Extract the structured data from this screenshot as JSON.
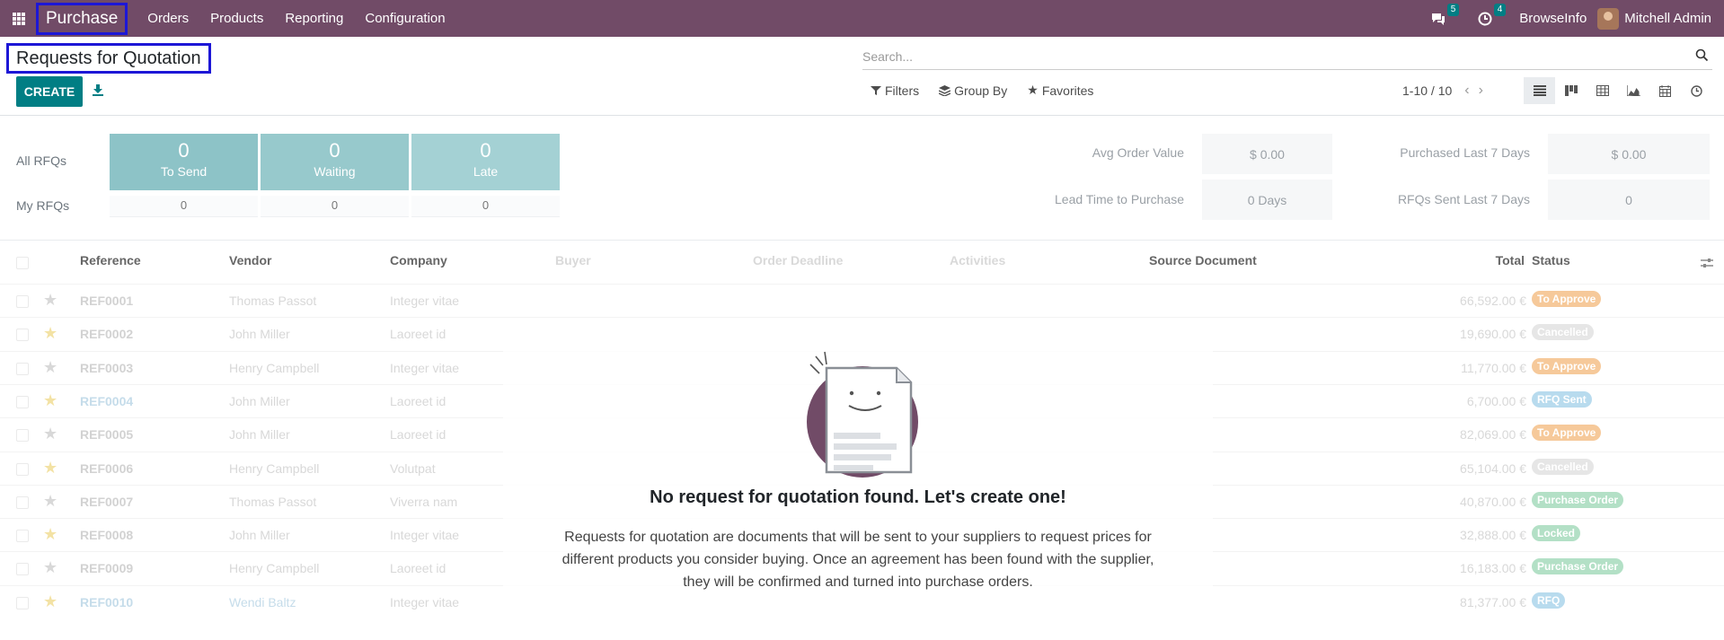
{
  "navbar": {
    "app_name": "Purchase",
    "menu": [
      "Orders",
      "Products",
      "Reporting",
      "Configuration"
    ],
    "messages_count": "5",
    "activities_count": "4",
    "browse_info": "BrowseInfo",
    "user_name": "Mitchell Admin"
  },
  "control_panel": {
    "title": "Requests for Quotation",
    "create_label": "CREATE",
    "search_placeholder": "Search...",
    "filters_label": "Filters",
    "group_by_label": "Group By",
    "favorites_label": "Favorites",
    "pager": "1-10 / 10"
  },
  "dashboard": {
    "all_rfqs_label": "All RFQs",
    "my_rfqs_label": "My RFQs",
    "tiles": [
      {
        "value": "0",
        "label": "To Send",
        "my_value": "0"
      },
      {
        "value": "0",
        "label": "Waiting",
        "my_value": "0"
      },
      {
        "value": "0",
        "label": "Late",
        "my_value": "0"
      }
    ],
    "kpis": {
      "avg_order_value_label": "Avg Order Value",
      "avg_order_value": "$ 0.00",
      "lead_time_label": "Lead Time to Purchase",
      "lead_time": "0 Days",
      "purchased_7d_label": "Purchased Last 7 Days",
      "purchased_7d": "$ 0.00",
      "rfqs_sent_7d_label": "RFQs Sent Last 7 Days",
      "rfqs_sent_7d": "0"
    }
  },
  "list": {
    "columns": [
      "Reference",
      "Vendor",
      "Company",
      "Buyer",
      "Order Deadline",
      "Activities",
      "Source Document",
      "Total",
      "Status"
    ],
    "rows": [
      {
        "ref": "REF0001",
        "vendor": "Thomas Passot",
        "company": "Integer vitae",
        "total": "66,592.00 €",
        "status": "To Approve",
        "starred": false
      },
      {
        "ref": "REF0002",
        "vendor": "John Miller",
        "company": "Laoreet id",
        "total": "19,690.00 €",
        "status": "Cancelled",
        "starred": true
      },
      {
        "ref": "REF0003",
        "vendor": "Henry Campbell",
        "company": "Integer vitae",
        "total": "11,770.00 €",
        "status": "To Approve",
        "starred": false
      },
      {
        "ref": "REF0004",
        "vendor": "John Miller",
        "company": "Laoreet id",
        "total": "6,700.00 €",
        "status": "RFQ Sent",
        "starred": true
      },
      {
        "ref": "REF0005",
        "vendor": "John Miller",
        "company": "Laoreet id",
        "total": "82,069.00 €",
        "status": "To Approve",
        "starred": false
      },
      {
        "ref": "REF0006",
        "vendor": "Henry Campbell",
        "company": "Volutpat",
        "total": "65,104.00 €",
        "status": "Cancelled",
        "starred": true
      },
      {
        "ref": "REF0007",
        "vendor": "Thomas Passot",
        "company": "Viverra nam",
        "total": "40,870.00 €",
        "status": "Purchase Order",
        "starred": false
      },
      {
        "ref": "REF0008",
        "vendor": "John Miller",
        "company": "Integer vitae",
        "total": "32,888.00 €",
        "status": "Locked",
        "starred": true
      },
      {
        "ref": "REF0009",
        "vendor": "Henry Campbell",
        "company": "Laoreet id",
        "total": "16,183.00 €",
        "status": "Purchase Order",
        "starred": false
      },
      {
        "ref": "REF0010",
        "vendor": "Wendi Baltz",
        "company": "Integer vitae",
        "total": "81,377.00 €",
        "status": "RFQ",
        "starred": true
      }
    ]
  },
  "helper": {
    "title": "No request for quotation found. Let's create one!",
    "text": "Requests for quotation are documents that will be sent to your suppliers to request prices for different products you consider buying. Once an agreement has been found with the supplier, they will be confirmed and turned into purchase orders."
  },
  "colors": {
    "navbar": "#714b67",
    "primary": "#017e84",
    "tile": "#8fc4c8",
    "highlight_border": "#1d17d6"
  }
}
